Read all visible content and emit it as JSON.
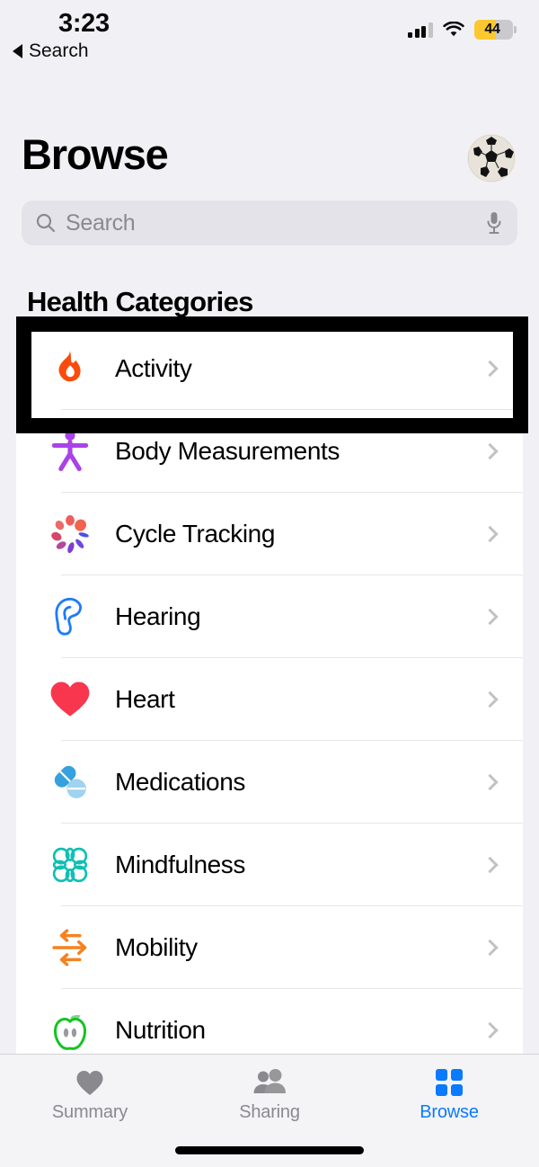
{
  "status_bar": {
    "time": "3:23",
    "back_label": "Search",
    "back_icon": "back-triangle-icon",
    "signal_icon": "cellular-signal-icon",
    "wifi_icon": "wifi-icon",
    "battery_level": "44",
    "battery_icon": "battery-low-power-icon",
    "battery_color": "#FDC72F"
  },
  "header": {
    "title": "Browse",
    "avatar_name": "soccer-ball-avatar"
  },
  "search": {
    "placeholder": "Search",
    "search_icon": "search-icon",
    "mic_icon": "microphone-icon"
  },
  "section": {
    "title": "Health Categories"
  },
  "categories": [
    {
      "label": "Activity",
      "icon": "flame-icon",
      "color": "#FB4B0C",
      "highlighted": true
    },
    {
      "label": "Body Measurements",
      "icon": "body-figure-icon",
      "color": "#A943E8",
      "highlighted": false
    },
    {
      "label": "Cycle Tracking",
      "icon": "cycle-petals-icon",
      "color": "#E8565C",
      "highlighted": false
    },
    {
      "label": "Hearing",
      "icon": "ear-icon",
      "color": "#1E7DF5",
      "highlighted": false
    },
    {
      "label": "Heart",
      "icon": "heart-icon",
      "color": "#F8374F",
      "highlighted": false
    },
    {
      "label": "Medications",
      "icon": "pill-capsule-icon",
      "color": "#35A1DE",
      "highlighted": false
    },
    {
      "label": "Mindfulness",
      "icon": "brain-mindfulness-icon",
      "color": "#0FC0B3",
      "highlighted": false
    },
    {
      "label": "Mobility",
      "icon": "mobility-arrows-icon",
      "color": "#F58220",
      "highlighted": false
    },
    {
      "label": "Nutrition",
      "icon": "apple-icon",
      "color": "#14C425",
      "highlighted": false
    }
  ],
  "tabs": [
    {
      "label": "Summary",
      "icon": "heart-tab-icon",
      "active": false
    },
    {
      "label": "Sharing",
      "icon": "people-tab-icon",
      "active": false
    },
    {
      "label": "Browse",
      "icon": "grid-tab-icon",
      "active": true
    }
  ],
  "colors": {
    "accent": "#0A7AFF",
    "background": "#F1F1F5",
    "card": "#FFFFFF",
    "highlight_box": "#000000"
  }
}
